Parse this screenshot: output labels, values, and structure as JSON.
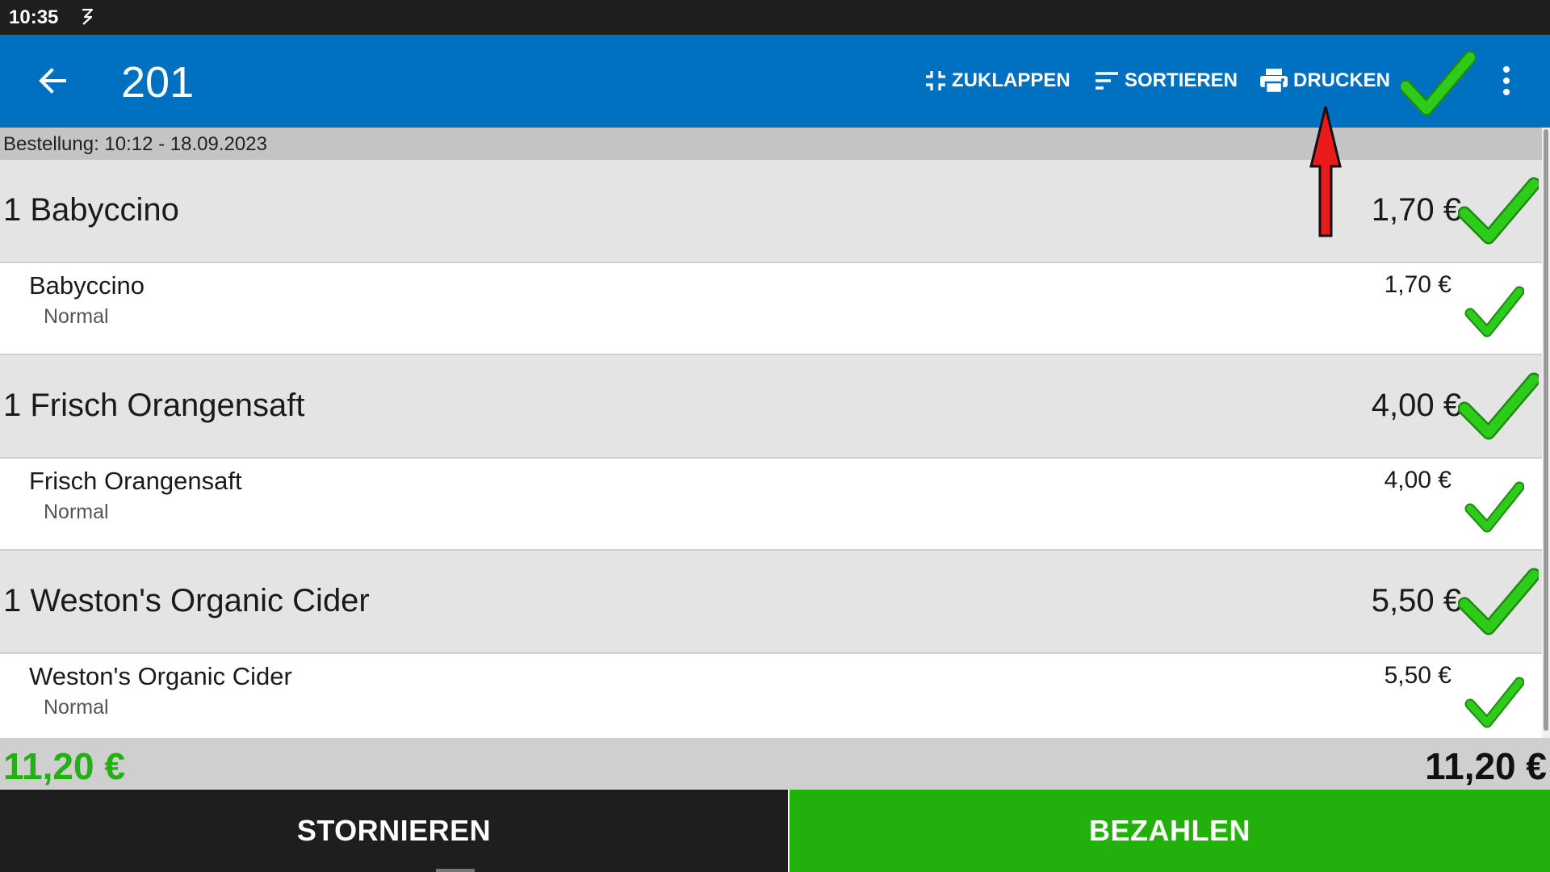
{
  "status_bar": {
    "time": "10:35"
  },
  "app_bar": {
    "title": "201",
    "actions": {
      "collapse": "ZUKLAPPEN",
      "sort": "SORTIEREN",
      "print": "DRUCKEN"
    }
  },
  "order": {
    "header": "Bestellung: 10:12 - 18.09.2023",
    "groups": [
      {
        "title": "1 Babyccino",
        "price": "1,70 €",
        "item": {
          "name": "Babyccino",
          "variant": "Normal",
          "price": "1,70 €"
        }
      },
      {
        "title": "1 Frisch Orangensaft",
        "price": "4,00 €",
        "item": {
          "name": "Frisch Orangensaft",
          "variant": "Normal",
          "price": "4,00 €"
        }
      },
      {
        "title": "1 Weston's Organic Cider",
        "price": "5,50 €",
        "item": {
          "name": "Weston's Organic Cider",
          "variant": "Normal",
          "price": "5,50 €"
        }
      }
    ]
  },
  "totals": {
    "left": "11,20 €",
    "right": "11,20 €"
  },
  "buttons": {
    "cancel": "STORNIEREN",
    "pay": "BEZAHLEN"
  },
  "colors": {
    "app_bar": "#0071c1",
    "check_green": "#22c414",
    "pay_green": "#22b00a",
    "total_green": "#22b014",
    "annotation_red": "#e81a1a"
  }
}
